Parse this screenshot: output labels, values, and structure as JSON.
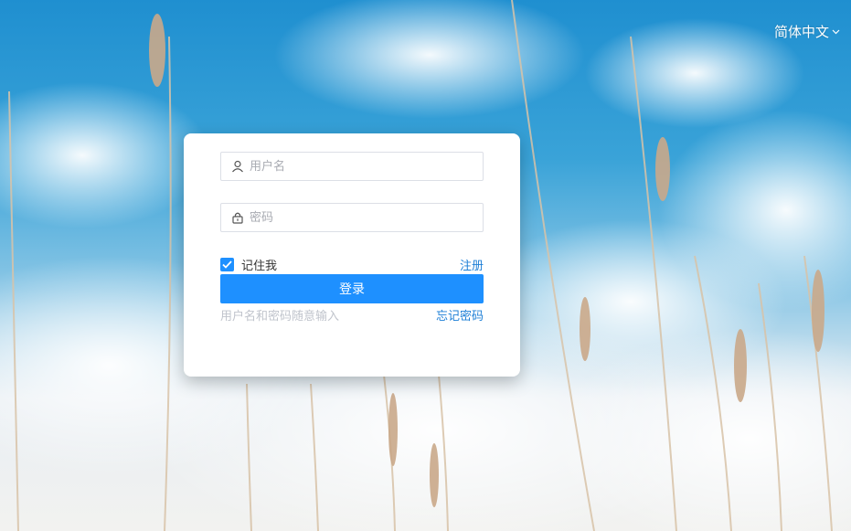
{
  "header": {
    "language_label": "简体中文",
    "language_chevron": "chevron-down-icon"
  },
  "login_form": {
    "username_placeholder": "用户名",
    "password_placeholder": "密码",
    "remember_label": "记住我",
    "remember_checked": true,
    "register_label": "注册",
    "login_label": "登录",
    "hint_text": "用户名和密码随意输入",
    "forgot_label": "忘记密码"
  },
  "colors": {
    "primary": "#1e90ff",
    "link": "#1e7fd6",
    "hint": "#c0c4cc"
  }
}
